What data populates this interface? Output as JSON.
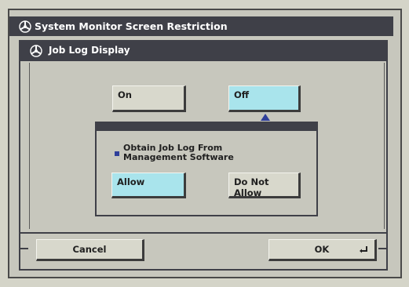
{
  "window": {
    "title": "System Monitor Screen Restriction",
    "title_icon": "settings-wheel-icon"
  },
  "panel": {
    "title": "Job Log Display",
    "title_icon": "settings-wheel-icon"
  },
  "toggle": {
    "on_label": "On",
    "off_label": "Off",
    "selected": "Off"
  },
  "setting": {
    "label": "Obtain Job Log From Management Software"
  },
  "options": {
    "allow_label": "Allow",
    "do_not_allow_label": "Do Not Allow",
    "selected": "Allow"
  },
  "footer": {
    "cancel_label": "Cancel",
    "ok_label": "OK",
    "ok_icon": "enter-return-icon"
  },
  "colors": {
    "titlebar": "#3f4048",
    "background": "#c7c7bd",
    "selected": "#a9e4ec",
    "accent": "#2f3f9a"
  }
}
